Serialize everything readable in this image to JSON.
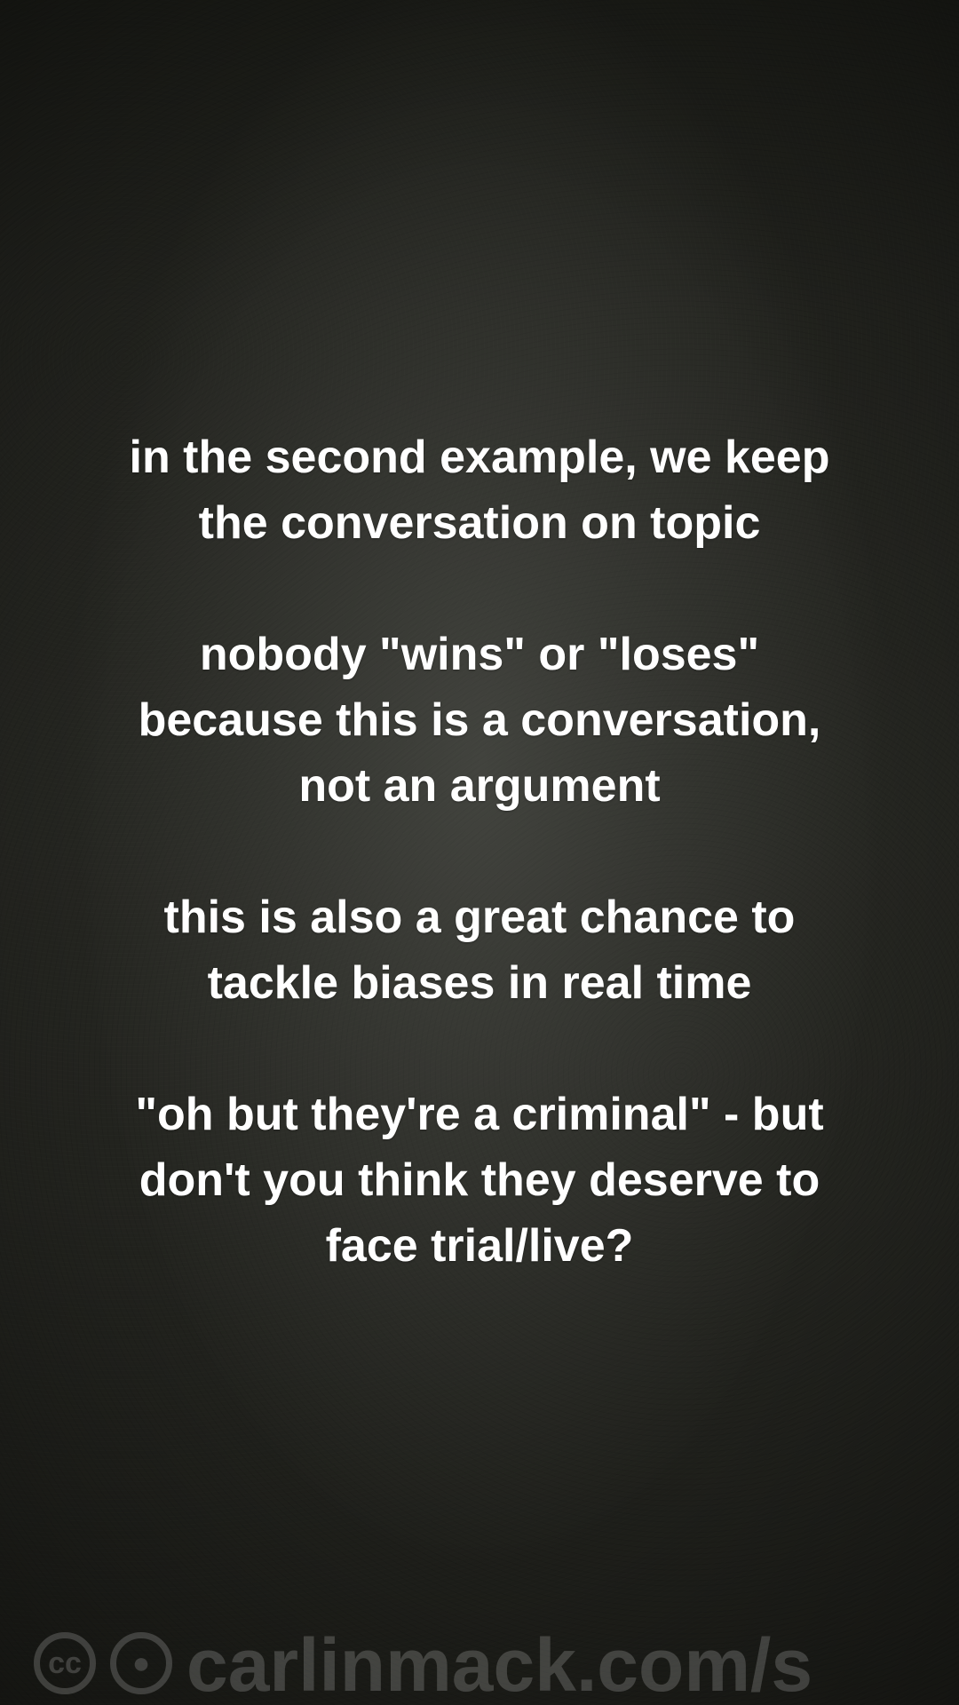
{
  "paragraphs": [
    [
      "in the second example, we keep",
      "the conversation on topic"
    ],
    [
      "nobody \"wins\" or \"loses\"",
      "because this is a conversation,",
      "not an argument"
    ],
    [
      "this is also a great chance to",
      "tackle biases in real time"
    ],
    [
      "\"oh but they're a criminal\" - but",
      "don't you think they deserve to",
      "face trial/live?"
    ]
  ],
  "watermark": {
    "text": "carlinmack.com/s",
    "icons": [
      "cc-icon",
      "by-icon"
    ]
  },
  "colors": {
    "text": "#ffffff",
    "background": "#5f605a"
  }
}
